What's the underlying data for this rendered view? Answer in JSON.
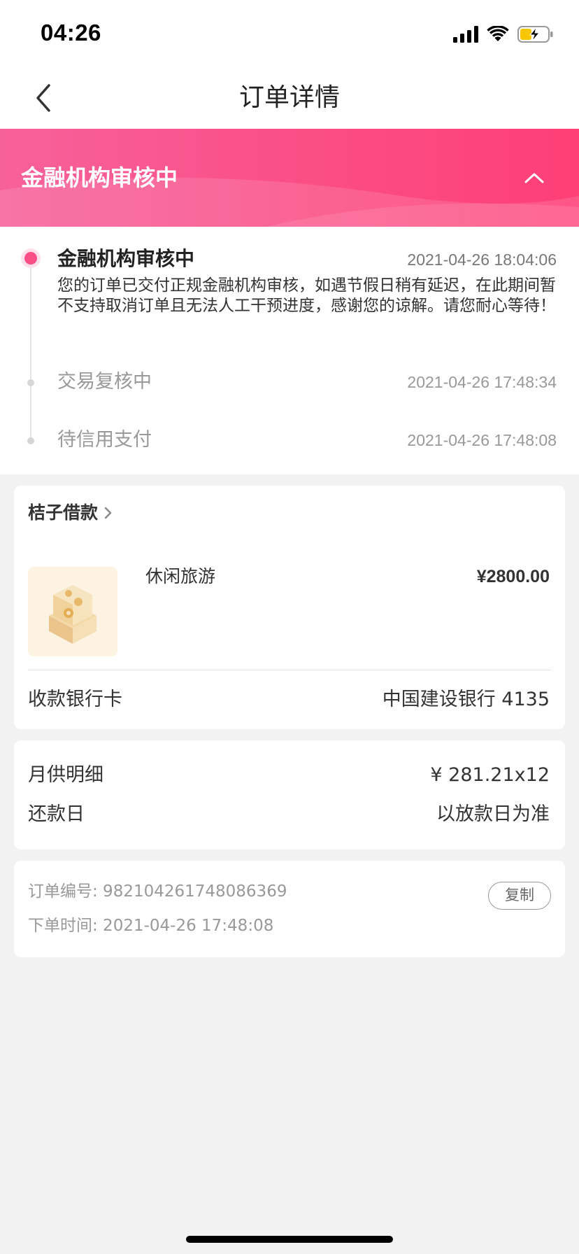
{
  "status_bar": {
    "time": "04:26"
  },
  "nav": {
    "title": "订单详情"
  },
  "banner": {
    "title": "金融机构审核中"
  },
  "timeline": {
    "steps": [
      {
        "title": "金融机构审核中",
        "time": "2021-04-26 18:04:06",
        "description": "您的订单已交付正规金融机构审核，如遇节假日稍有延迟，在此期间暂不支持取消订单且无法人工干预进度，感谢您的谅解。请您耐心等待！"
      },
      {
        "title": "交易复核中",
        "time": "2021-04-26 17:48:34"
      },
      {
        "title": "待信用支付",
        "time": "2021-04-26 17:48:08"
      }
    ]
  },
  "merchant": {
    "name": "桔子借款",
    "product_name": "休闲旅游",
    "product_price": "¥2800.00",
    "bank_label": "收款银行卡",
    "bank_value": "中国建设银行 4135"
  },
  "repayment": {
    "monthly_label": "月供明细",
    "monthly_value": "¥ 281.21x12",
    "day_label": "还款日",
    "day_value": "以放款日为准"
  },
  "order": {
    "number_text": "订单编号: 982104261748086369",
    "time_text": "下单时间: 2021-04-26 17:48:08",
    "copy_label": "复制"
  },
  "colors": {
    "accent": "#fb4d86",
    "banner_start": "#f7619a",
    "banner_end": "#fe3f76"
  }
}
